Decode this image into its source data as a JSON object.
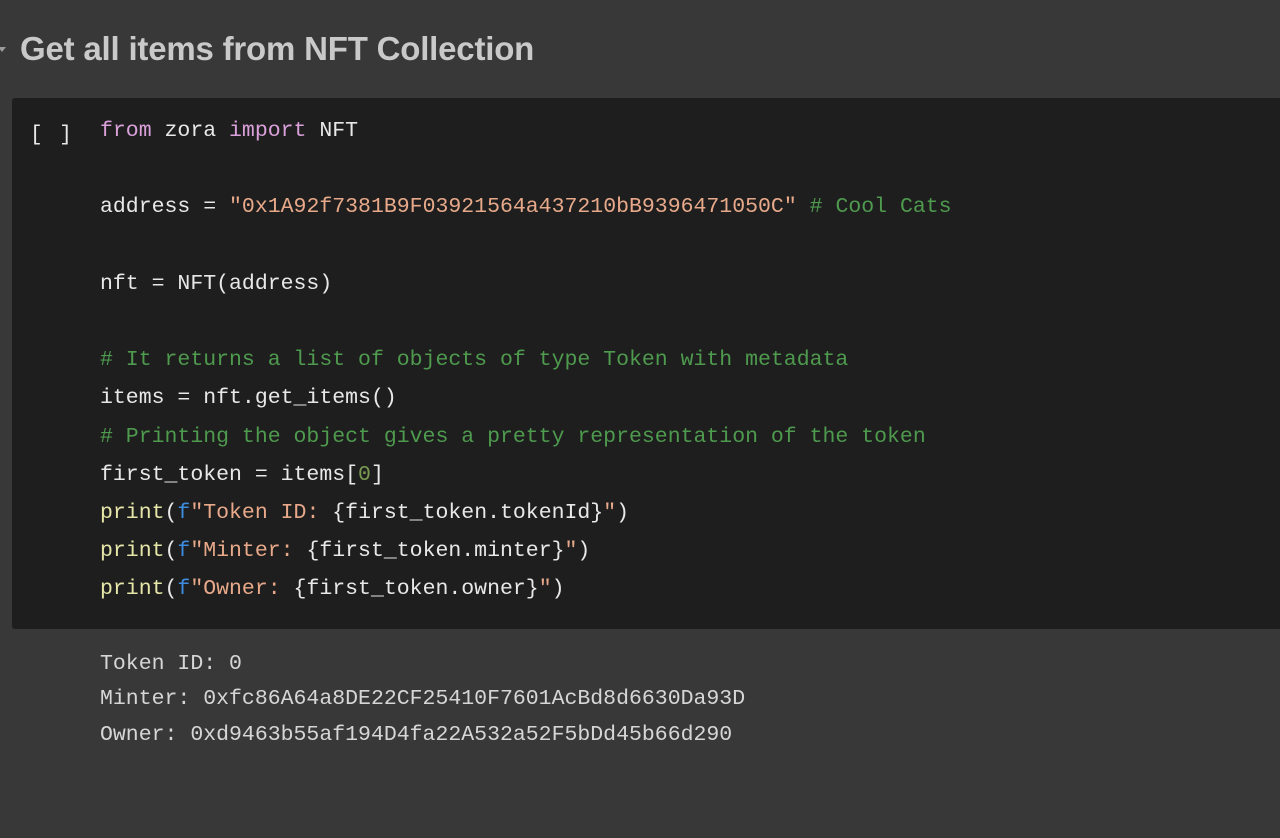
{
  "section": {
    "title": "Get all items from NFT Collection",
    "collapse_icon": "chevron-down-icon",
    "expanded": true
  },
  "colors": {
    "page_background": "#383838",
    "code_background": "#1e1e1e",
    "title_text": "#c9c9c9",
    "code_text": "#e8e8e8",
    "keyword": "#d9a0d9",
    "string": "#e8a98a",
    "comment": "#4e9a4e",
    "number": "#7a9a52",
    "function": "#e6e6a8",
    "fstring_prefix": "#3d8ce0",
    "output_text": "#d6d6d6"
  },
  "code_cell": {
    "run_marker": "[ ]",
    "language": "python",
    "lines": [
      {
        "id": "line-1",
        "tokens": [
          {
            "t": "from",
            "c": "kw"
          },
          {
            "t": " zora ",
            "c": "name"
          },
          {
            "t": "import",
            "c": "kw"
          },
          {
            "t": " NFT",
            "c": "name"
          }
        ]
      },
      {
        "id": "line-2",
        "tokens": []
      },
      {
        "id": "line-3",
        "tokens": [
          {
            "t": "address = ",
            "c": "name"
          },
          {
            "t": "\"0x1A92f7381B9F03921564a437210bB9396471050C\"",
            "c": "str"
          },
          {
            "t": " ",
            "c": "plain"
          },
          {
            "t": "# Cool Cats",
            "c": "com"
          }
        ]
      },
      {
        "id": "line-4",
        "tokens": []
      },
      {
        "id": "line-5",
        "tokens": [
          {
            "t": "nft = NFT(address)",
            "c": "name"
          }
        ]
      },
      {
        "id": "line-6",
        "tokens": []
      },
      {
        "id": "line-7",
        "tokens": [
          {
            "t": "# It returns a list of objects of type Token with metadata",
            "c": "com"
          }
        ]
      },
      {
        "id": "line-8",
        "tokens": [
          {
            "t": "items = nft.get_items()",
            "c": "name"
          }
        ]
      },
      {
        "id": "line-9",
        "tokens": [
          {
            "t": "# Printing the object gives a pretty representation of the token",
            "c": "com"
          }
        ]
      },
      {
        "id": "line-10",
        "tokens": [
          {
            "t": "first_token = items[",
            "c": "name"
          },
          {
            "t": "0",
            "c": "num"
          },
          {
            "t": "]",
            "c": "name"
          }
        ]
      },
      {
        "id": "line-11",
        "tokens": [
          {
            "t": "print",
            "c": "fn"
          },
          {
            "t": "(",
            "c": "plain"
          },
          {
            "t": "f",
            "c": "fpre"
          },
          {
            "t": "\"Token ID: ",
            "c": "str"
          },
          {
            "t": "{first_token.tokenId}",
            "c": "name"
          },
          {
            "t": "\"",
            "c": "str"
          },
          {
            "t": ")",
            "c": "plain"
          }
        ]
      },
      {
        "id": "line-12",
        "tokens": [
          {
            "t": "print",
            "c": "fn"
          },
          {
            "t": "(",
            "c": "plain"
          },
          {
            "t": "f",
            "c": "fpre"
          },
          {
            "t": "\"Minter: ",
            "c": "str"
          },
          {
            "t": "{first_token.minter}",
            "c": "name"
          },
          {
            "t": "\"",
            "c": "str"
          },
          {
            "t": ")",
            "c": "plain"
          }
        ]
      },
      {
        "id": "line-13",
        "tokens": [
          {
            "t": "print",
            "c": "fn"
          },
          {
            "t": "(",
            "c": "plain"
          },
          {
            "t": "f",
            "c": "fpre"
          },
          {
            "t": "\"Owner: ",
            "c": "str"
          },
          {
            "t": "{first_token.owner}",
            "c": "name"
          },
          {
            "t": "\"",
            "c": "str"
          },
          {
            "t": ")",
            "c": "plain"
          }
        ]
      }
    ]
  },
  "output": {
    "lines": [
      "Token ID: 0",
      "Minter: 0xfc86A64a8DE22CF25410F7601AcBd8d6630Da93D",
      "Owner: 0xd9463b55af194D4fa22A532a52F5bDd45b66d290"
    ]
  }
}
